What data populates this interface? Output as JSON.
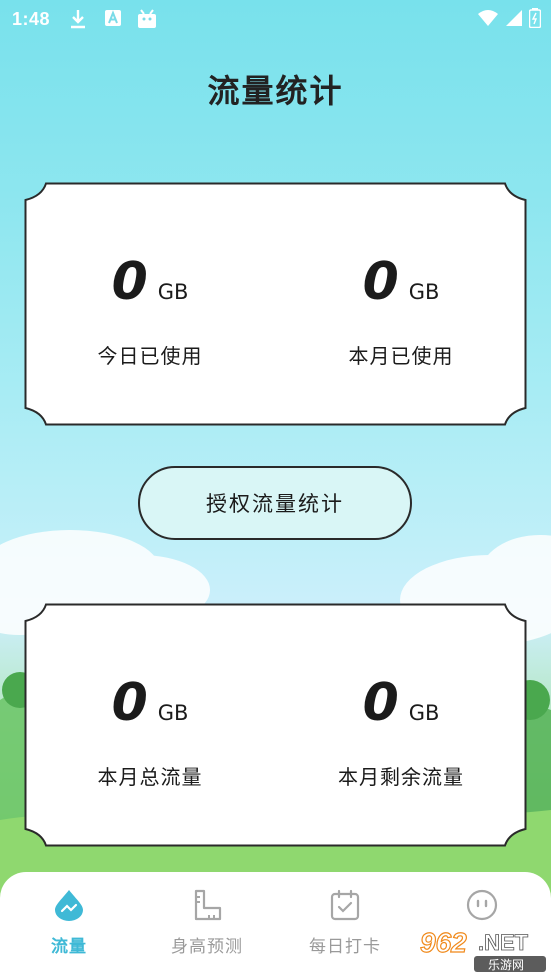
{
  "status_bar": {
    "time": "1:48",
    "icons": [
      "download-icon",
      "a-icon",
      "android-icon",
      "wifi-icon",
      "signal-icon",
      "battery-icon"
    ]
  },
  "page": {
    "title": "流量统计"
  },
  "card_top": {
    "left": {
      "value": "0",
      "unit": "GB",
      "label": "今日已使用"
    },
    "right": {
      "value": "0",
      "unit": "GB",
      "label": "本月已使用"
    }
  },
  "auth_button": {
    "label": "授权流量统计"
  },
  "card_bottom": {
    "left": {
      "value": "0",
      "unit": "GB",
      "label": "本月总流量"
    },
    "right": {
      "value": "0",
      "unit": "GB",
      "label": "本月剩余流量"
    }
  },
  "bottom_nav": {
    "items": [
      {
        "label": "流量",
        "icon": "traffic-drop-icon",
        "active": true
      },
      {
        "label": "身高预测",
        "icon": "ruler-icon",
        "active": false
      },
      {
        "label": "每日打卡",
        "icon": "calendar-check-icon",
        "active": false
      },
      {
        "label": "",
        "icon": "face-icon",
        "active": false
      }
    ]
  },
  "watermark": {
    "brand": "962",
    "suffix": ".NET",
    "cn": "乐游网"
  },
  "colors": {
    "accent": "#3fb9d6",
    "card_bg": "#ffffff",
    "button_bg": "#d9f6f6",
    "text": "#1b1b1b",
    "inactive": "#9a9a9a"
  }
}
